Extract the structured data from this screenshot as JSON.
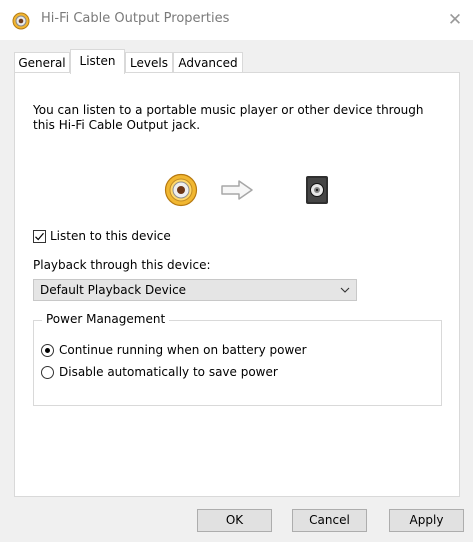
{
  "window": {
    "title": "Hi-Fi Cable Output Properties",
    "close_glyph": "✕"
  },
  "tabs": [
    {
      "label": "General"
    },
    {
      "label": "Listen",
      "active": true
    },
    {
      "label": "Levels"
    },
    {
      "label": "Advanced"
    }
  ],
  "listen": {
    "description": "You can listen to a portable music player or other device through this Hi-Fi Cable Output jack.",
    "icons": [
      "audio-jack-icon",
      "right-arrow-icon",
      "speaker-icon"
    ],
    "listen_checkbox": {
      "label": "Listen to this device",
      "checked": true
    },
    "playback_label": "Playback through this device:",
    "playback_device": "Default Playback Device",
    "power_management": {
      "title": "Power Management",
      "options": [
        {
          "label": "Continue running when on battery power",
          "selected": true
        },
        {
          "label": "Disable automatically to save power",
          "selected": false
        }
      ]
    }
  },
  "buttons": {
    "ok": "OK",
    "cancel": "Cancel",
    "apply": "Apply"
  }
}
